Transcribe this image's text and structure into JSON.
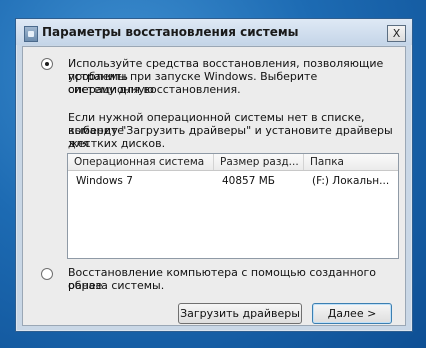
{
  "window": {
    "title": "Параметры восстановления системы",
    "close_label": "X"
  },
  "option_tools": {
    "line1": "Используйте средства восстановления, позволяющие устранить",
    "line2": "проблемы при запуске Windows. Выберите операционную",
    "line3": "систему для восстановления.",
    "selected": true
  },
  "hint": {
    "line1": "Если нужной операционной системы нет в списке, выберите",
    "line2": "команду \"Загрузить драйверы\" и установите драйверы для",
    "line3": "жестких дисков."
  },
  "os_table": {
    "columns": [
      "Операционная система",
      "Размер разд...",
      "Папка"
    ],
    "rows": [
      [
        "Windows 7",
        "40857 МБ",
        "(F:) Локальн..."
      ]
    ]
  },
  "option_image": {
    "line1": "Восстановление компьютера с помощью созданного ранее",
    "line2": "образа системы.",
    "selected": false
  },
  "buttons": {
    "load_drivers": "Загрузить драйверы",
    "next": "Далее >"
  }
}
